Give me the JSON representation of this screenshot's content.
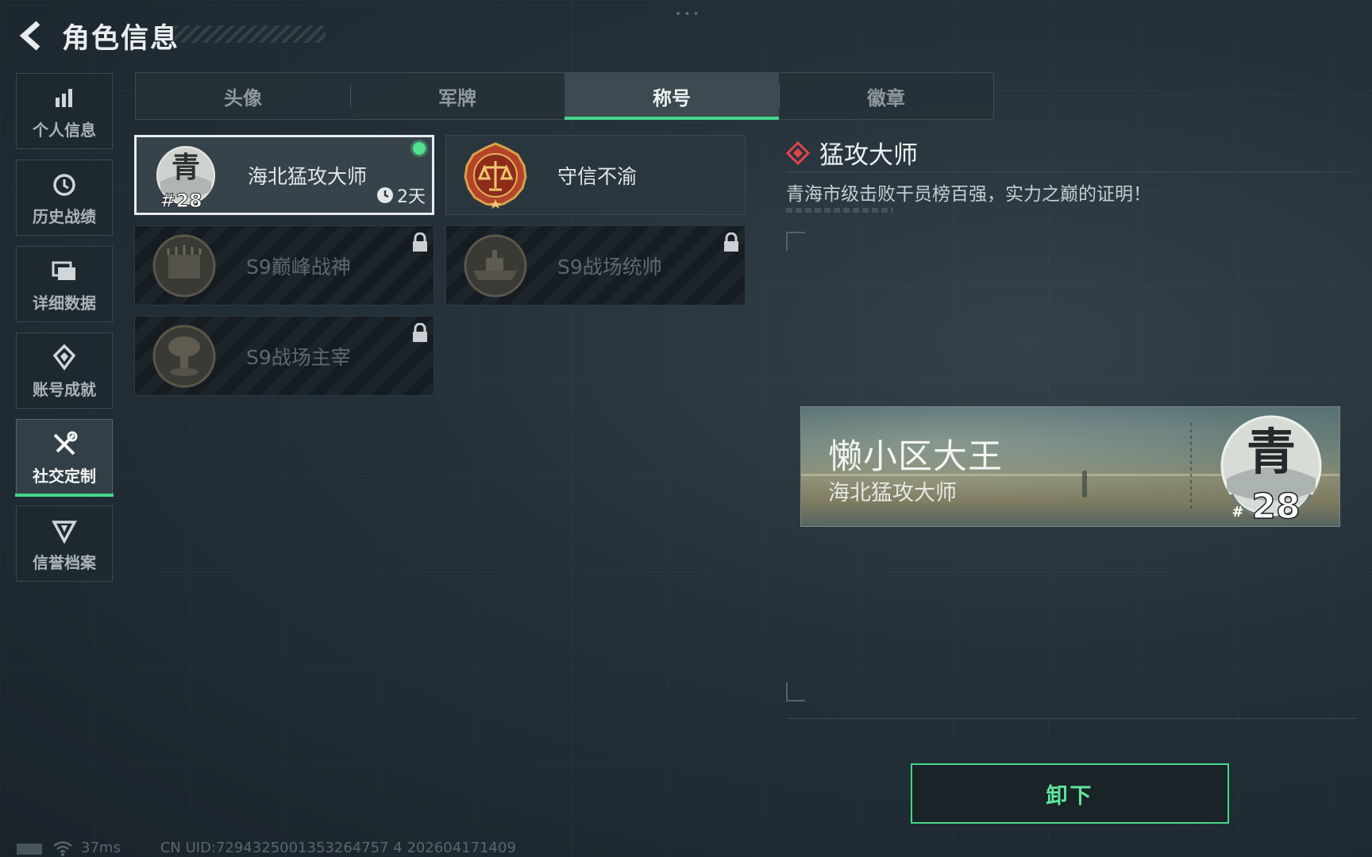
{
  "header": {
    "title": "角色信息"
  },
  "sidebar": {
    "items": [
      {
        "label": "个人信息",
        "icon": "bar-chart-icon"
      },
      {
        "label": "历史战绩",
        "icon": "history-icon"
      },
      {
        "label": "详细数据",
        "icon": "folder-icon"
      },
      {
        "label": "账号成就",
        "icon": "achievement-icon"
      },
      {
        "label": "社交定制",
        "icon": "tools-icon",
        "active": true
      },
      {
        "label": "信誉档案",
        "icon": "credit-icon"
      }
    ]
  },
  "tabs": [
    {
      "label": "头像"
    },
    {
      "label": "军牌"
    },
    {
      "label": "称号",
      "active": true
    },
    {
      "label": "徽章"
    }
  ],
  "titles": [
    {
      "name": "海北猛攻大师",
      "badge_text": "青",
      "badge_number": "#28",
      "timer": "2天",
      "equipped": true
    },
    {
      "name": "守信不渝",
      "badge_icon": "scales-icon"
    },
    {
      "name": "S9巅峰战神",
      "locked": true
    },
    {
      "name": "S9战场统帅",
      "locked": true
    },
    {
      "name": "S9战场主宰",
      "locked": true
    }
  ],
  "detail": {
    "title": "猛攻大师",
    "description": "青海市级击败干员榜百强，实力之巅的证明！"
  },
  "preview": {
    "player_name": "懒小区大王",
    "player_title": "海北猛攻大师",
    "emblem_text": "青",
    "emblem_number": "28"
  },
  "actions": {
    "unequip_label": "卸下"
  },
  "status": {
    "ping": "37ms",
    "uid": "CN UID:7294325001353264757 4 202604171409"
  },
  "colors": {
    "accent": "#45d68c",
    "detail_marker": "#e0444a"
  }
}
